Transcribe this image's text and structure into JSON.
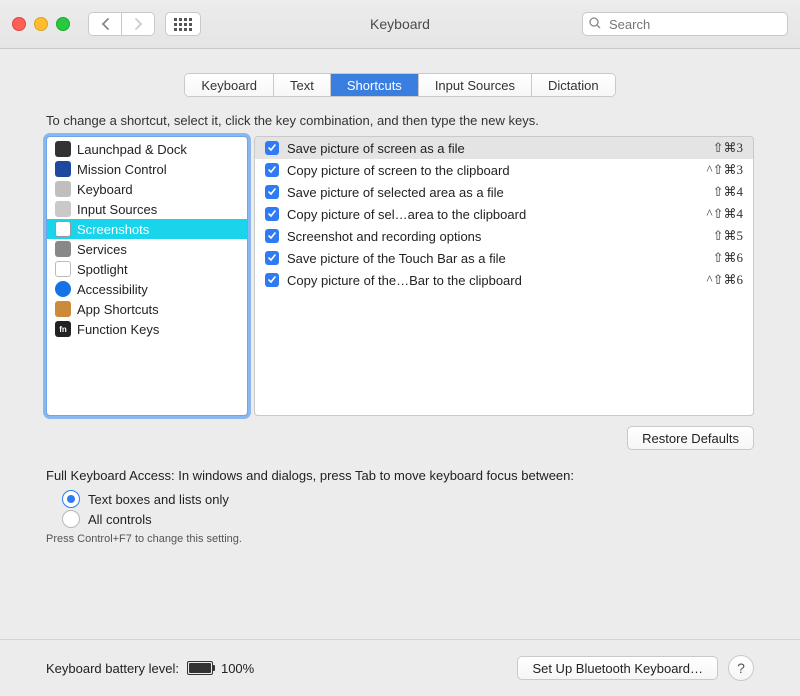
{
  "window": {
    "title": "Keyboard"
  },
  "search": {
    "placeholder": "Search"
  },
  "tabs": [
    {
      "label": "Keyboard",
      "active": false
    },
    {
      "label": "Text",
      "active": false
    },
    {
      "label": "Shortcuts",
      "active": true
    },
    {
      "label": "Input Sources",
      "active": false
    },
    {
      "label": "Dictation",
      "active": false
    }
  ],
  "hint": "To change a shortcut, select it, click the key combination, and then type the new keys.",
  "categories": [
    {
      "label": "Launchpad & Dock",
      "icon": "ic-launchpad",
      "sel": false
    },
    {
      "label": "Mission Control",
      "icon": "ic-mission",
      "sel": false
    },
    {
      "label": "Keyboard",
      "icon": "ic-keyboard",
      "sel": false
    },
    {
      "label": "Input Sources",
      "icon": "ic-input",
      "sel": false
    },
    {
      "label": "Screenshots",
      "icon": "ic-screen",
      "sel": true
    },
    {
      "label": "Services",
      "icon": "ic-services",
      "sel": false
    },
    {
      "label": "Spotlight",
      "icon": "ic-spotlight",
      "sel": false
    },
    {
      "label": "Accessibility",
      "icon": "ic-access",
      "sel": false
    },
    {
      "label": "App Shortcuts",
      "icon": "ic-app",
      "sel": false
    },
    {
      "label": "Function Keys",
      "icon": "ic-fn",
      "glyph": "fn",
      "sel": false
    }
  ],
  "shortcuts": [
    {
      "checked": true,
      "label": "Save picture of screen as a file",
      "key": "⇧⌘3",
      "sel": true
    },
    {
      "checked": true,
      "label": "Copy picture of screen to the clipboard",
      "key": "^⇧⌘3",
      "sel": false
    },
    {
      "checked": true,
      "label": "Save picture of selected area as a file",
      "key": "⇧⌘4",
      "sel": false
    },
    {
      "checked": true,
      "label": "Copy picture of sel…area to the clipboard",
      "key": "^⇧⌘4",
      "sel": false
    },
    {
      "checked": true,
      "label": "Screenshot and recording options",
      "key": "⇧⌘5",
      "sel": false
    },
    {
      "checked": true,
      "label": "Save picture of the Touch Bar as a file",
      "key": "⇧⌘6",
      "sel": false
    },
    {
      "checked": true,
      "label": "Copy picture of the…Bar to the clipboard",
      "key": "^⇧⌘6",
      "sel": false
    }
  ],
  "restore_label": "Restore Defaults",
  "kbd_access": {
    "heading": "Full Keyboard Access: In windows and dialogs, press Tab to move keyboard focus between:",
    "opt1": "Text boxes and lists only",
    "opt2": "All controls",
    "hint": "Press Control+F7 to change this setting."
  },
  "battery": {
    "label": "Keyboard battery level:",
    "pct": "100%"
  },
  "bluetooth_label": "Set Up Bluetooth Keyboard…",
  "help": "?"
}
